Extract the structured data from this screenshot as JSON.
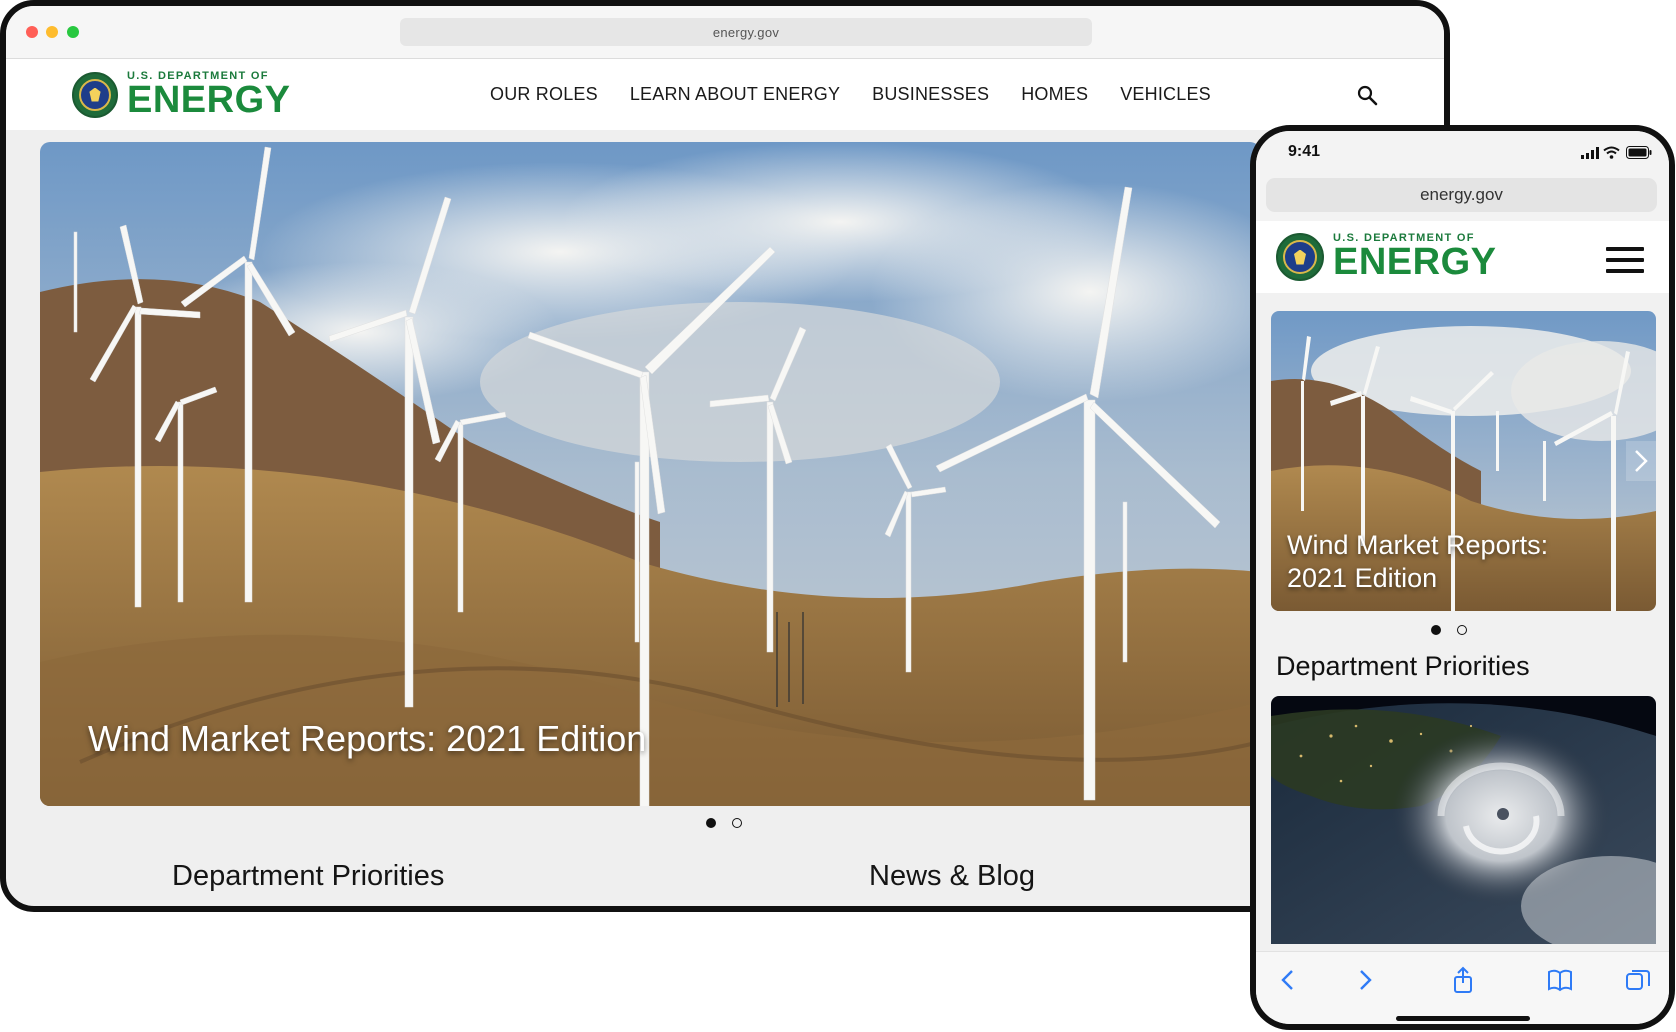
{
  "desktop": {
    "browser": {
      "url": "energy.gov"
    },
    "logo": {
      "small": "U.S. DEPARTMENT OF",
      "big": "ENERGY"
    },
    "nav": {
      "items": [
        {
          "label": "OUR ROLES"
        },
        {
          "label": "LEARN ABOUT ENERGY"
        },
        {
          "label": "BUSINESSES"
        },
        {
          "label": "HOMES"
        },
        {
          "label": "VEHICLES"
        }
      ],
      "search_icon": "search-icon"
    },
    "hero": {
      "title": "Wind Market Reports: 2021 Edition",
      "slide": 1,
      "slide_count": 2
    },
    "sections": {
      "priorities": "Department Priorities",
      "news": "News & Blog"
    }
  },
  "phone": {
    "status": {
      "time": "9:41"
    },
    "browser": {
      "url": "energy.gov"
    },
    "logo": {
      "small": "U.S. DEPARTMENT OF",
      "big": "ENERGY"
    },
    "menu_icon": "hamburger-icon",
    "hero": {
      "title_line1": "Wind Market Reports:",
      "title_line2": "2021 Edition",
      "slide": 1,
      "slide_count": 2
    },
    "priorities_title": "Department Priorities",
    "toolbar": [
      "back-icon",
      "forward-icon",
      "share-icon",
      "bookmarks-icon",
      "tabs-icon"
    ]
  },
  "colors": {
    "brand_green": "#1b8a3c",
    "seal_blue": "#1e3d8a",
    "ios_blue": "#2f7bf6"
  }
}
